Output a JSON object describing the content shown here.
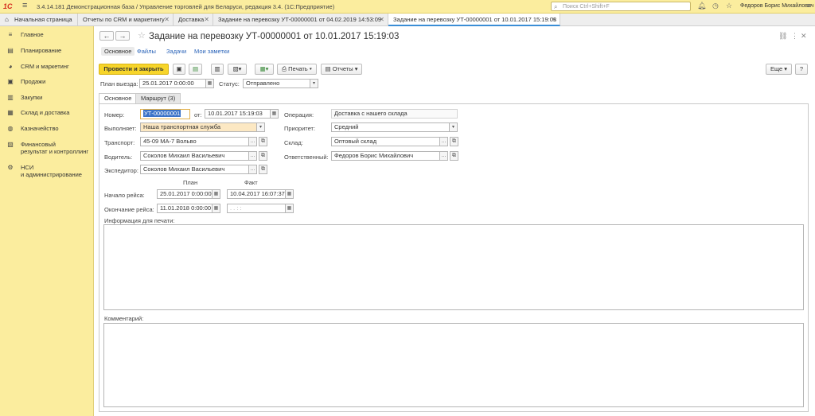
{
  "app": {
    "logo": "1С",
    "title": "3.4.14.181 Демонстрационная база / Управление торговлей для Беларуси, редакция 3.4.  (1С:Предприятие)",
    "search_placeholder": "Поиск Ctrl+Shift+F",
    "user": "Федоров Борис Михайлович"
  },
  "tabs": {
    "home": "Начальная страница",
    "t1": "Отчеты по CRM и маркетингу",
    "t2": "Доставка",
    "t3": "Задание на перевозку УТ-00000001 от 04.02.2019 14:53:09",
    "t4": "Задание на перевозку УТ-00000001 от 10.01.2017 15:19:03"
  },
  "sidebar": {
    "items": [
      {
        "label": "Главное",
        "icon": "≡"
      },
      {
        "label": "Планирование",
        "icon": "▤"
      },
      {
        "label": "CRM и маркетинг",
        "icon": "◕"
      },
      {
        "label": "Продажи",
        "icon": "▣"
      },
      {
        "label": "Закупки",
        "icon": "▥"
      },
      {
        "label": "Склад и доставка",
        "icon": "▦"
      },
      {
        "label": "Казначейство",
        "icon": "◍"
      },
      {
        "label": "Финансовый",
        "label2": "результат и контроллинг",
        "icon": "▧"
      },
      {
        "label": "НСИ",
        "label2": "и администрирование",
        "icon": "⚙"
      }
    ]
  },
  "doc": {
    "title": "Задание на перевозку УТ-00000001 от 10.01.2017 15:19:03",
    "form_tabs": [
      "Основное",
      "Файлы",
      "Задачи",
      "Мои заметки"
    ],
    "toolbar": {
      "post_close": "Провести и закрыть",
      "print": "Печать",
      "reports": "Отчеты",
      "more": "Еще",
      "help": "?"
    },
    "plan_departure_label": "План выезда:",
    "plan_departure": "25.01.2017  0:00:00",
    "status_label": "Статус:",
    "status": "Отправлено",
    "inner_tabs": [
      "Основное",
      "Маршрут (3)"
    ],
    "fields": {
      "number_label": "Номер:",
      "number": "УТ-00000001",
      "from_label": "от:",
      "date": "10.01.2017 15:19:03",
      "operation_label": "Операция:",
      "operation": "Доставка с нашего склада",
      "performer_label": "Выполняет:",
      "performer": "Наша транспортная служба",
      "priority_label": "Приоритет:",
      "priority": "Средний",
      "transport_label": "Транспорт:",
      "transport": "45-09 МА-7 Вольво",
      "warehouse_label": "Склад:",
      "warehouse": "Оптовый склад",
      "driver_label": "Водитель:",
      "driver": "Соколов Михаил Васильевич",
      "responsible_label": "Ответственный:",
      "responsible": "Федоров Борис Михайлович",
      "forwarder_label": "Экспедитор:",
      "forwarder": "Соколов Михаил Васильевич",
      "plan_header": "План",
      "fact_header": "Факт",
      "trip_start_label": "Начало рейса:",
      "trip_start_plan": "25.01.2017  0:00:00",
      "trip_start_fact": "10.04.2017 16:07:37",
      "trip_end_label": "Окончание рейса:",
      "trip_end_plan": "11.01.2018  0:00:00",
      "trip_end_fact": "  .  .       :  :  ",
      "print_info_label": "Информация для печати:",
      "comment_label": "Комментарий:"
    }
  }
}
